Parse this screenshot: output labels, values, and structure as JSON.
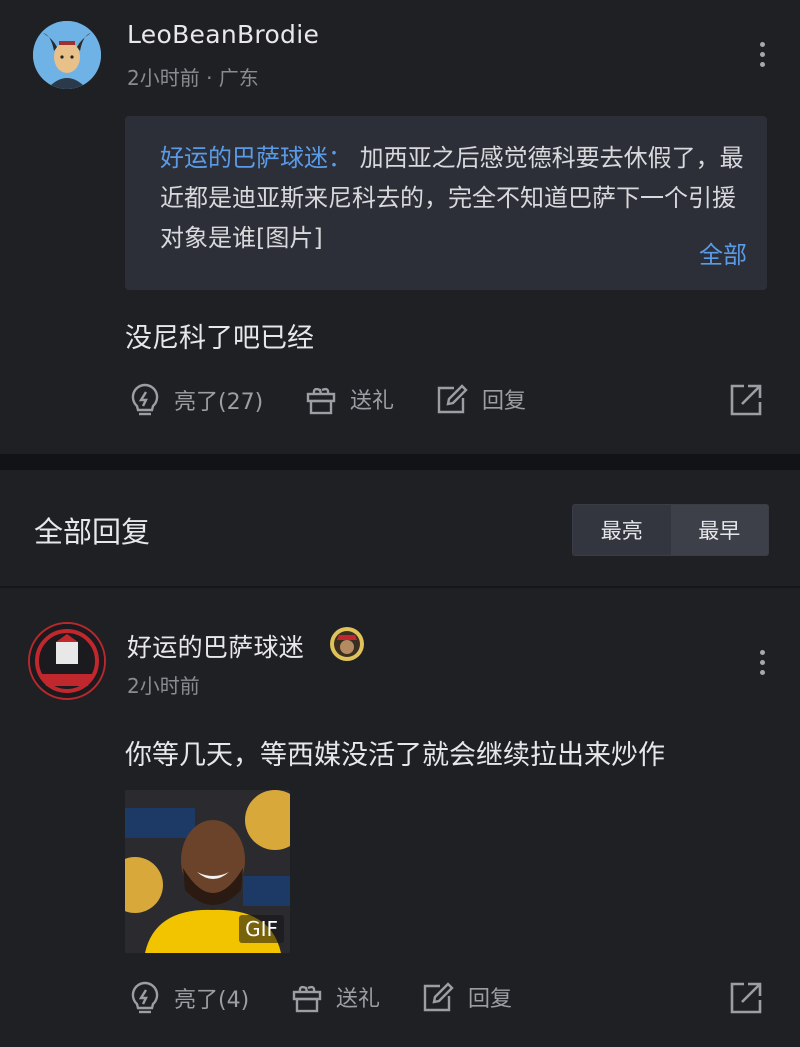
{
  "post": {
    "author": "LeoBeanBrodie",
    "meta": "2小时前 · 广东",
    "quote": {
      "author": "好运的巴萨球迷：",
      "text": "加西亚之后感觉德科要去休假了，最近都是迪亚斯来尼科去的，完全不知道巴萨下一个引援对象是谁[图片]",
      "expand_label": "全部"
    },
    "text": "没尼科了吧已经",
    "actions": {
      "like": "亮了(27)",
      "gift": "送礼",
      "reply": "回复"
    }
  },
  "replies_header": {
    "title": "全部回复",
    "sort_options": [
      "最亮",
      "最早"
    ]
  },
  "reply": {
    "author": "好运的巴萨球迷",
    "meta": "2小时前",
    "text": "你等几天，等西媒没活了就会继续拉出来炒作",
    "image_badge": "GIF",
    "actions": {
      "like": "亮了(4)",
      "gift": "送礼",
      "reply": "回复"
    }
  },
  "colors": {
    "background": "#1f2024",
    "accent": "#5a9be8",
    "quote_bg": "#2c2f37"
  }
}
